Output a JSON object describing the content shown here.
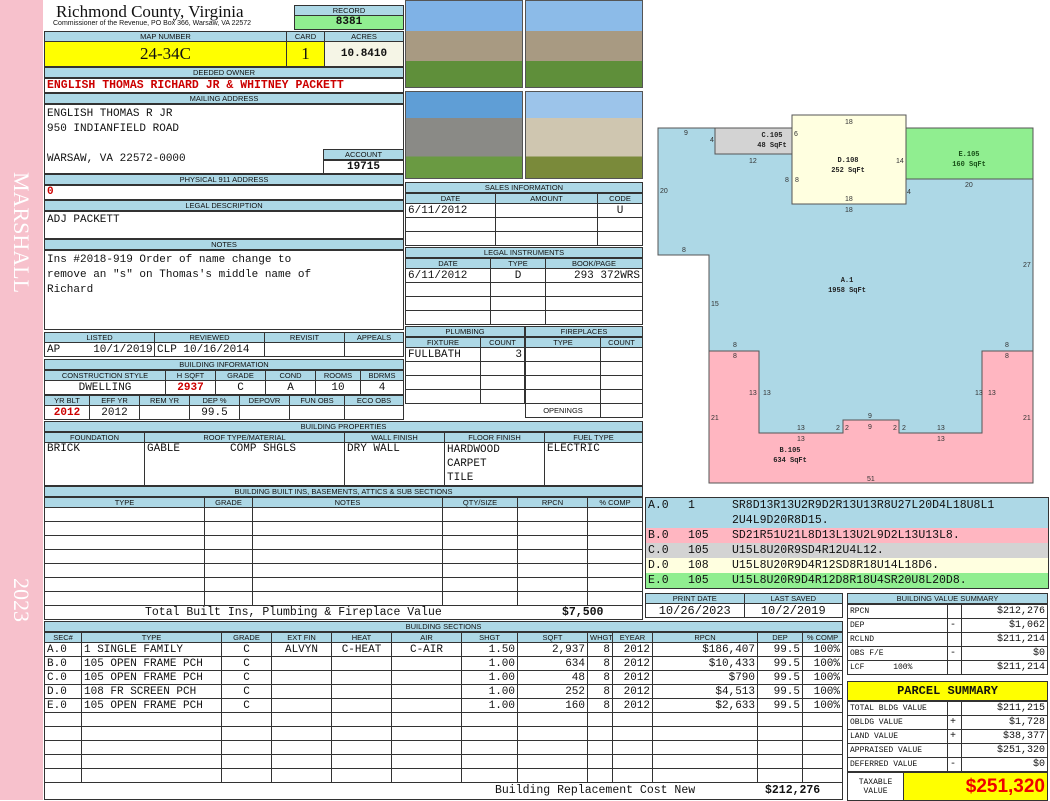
{
  "side": {
    "district": "MARSHALL",
    "year": "2023"
  },
  "header": {
    "county": "Richmond County, Virginia",
    "subtitle": "Commissioner of the Revenue, PO Box 366, Warsaw, VA 22572",
    "record_label": "RECORD",
    "record": "8381",
    "map_label": "MAP NUMBER",
    "map": "24-34C",
    "card_label": "CARD",
    "card": "1",
    "acres_label": "ACRES",
    "acres": "10.8410"
  },
  "owner": {
    "label": "DEEDED OWNER",
    "name": "ENGLISH THOMAS RICHARD JR & WHITNEY PACKETT",
    "mail_label": "MAILING ADDRESS",
    "mail": [
      "ENGLISH THOMAS R JR",
      "950 INDIANFIELD ROAD",
      "",
      "WARSAW, VA 22572-0000"
    ],
    "account_label": "ACCOUNT",
    "account": "19715",
    "phys_label": "PHYSICAL 911 ADDRESS",
    "phys": "0"
  },
  "legal": {
    "label": "LEGAL DESCRIPTION",
    "value": "ADJ PACKETT"
  },
  "notes": {
    "label": "NOTES",
    "lines": [
      "Ins #2018-919 Order of name change to",
      "remove an \"s\" on Thomas's middle name of",
      "Richard"
    ]
  },
  "sales": {
    "label": "SALES INFORMATION",
    "headers": [
      "DATE",
      "AMOUNT",
      "CODE"
    ],
    "rows": [
      [
        "6/11/2012",
        "",
        "U"
      ],
      [
        "",
        "",
        ""
      ],
      [
        "",
        "",
        ""
      ]
    ]
  },
  "instruments": {
    "label": "LEGAL INSTRUMENTS",
    "headers": [
      "DATE",
      "TYPE",
      "BOOK/PAGE"
    ],
    "rows": [
      [
        "6/11/2012",
        "D",
        "293 372WRS"
      ],
      [
        "",
        "",
        ""
      ],
      [
        "",
        "",
        ""
      ],
      [
        "",
        "",
        ""
      ]
    ]
  },
  "listing": {
    "headers": [
      "LISTED",
      "REVIEWED",
      "REVISIT",
      "APPEALS"
    ],
    "values": [
      "AP     10/1/2019",
      "CLP 10/16/2014",
      "",
      ""
    ]
  },
  "bldg_info": {
    "label": "BUILDING INFORMATION",
    "headers1": [
      "CONSTRUCTION STYLE",
      "H SQFT",
      "GRADE",
      "COND",
      "ROOMS",
      "BDRMS"
    ],
    "values1": [
      "DWELLING",
      "2937",
      "C",
      "A",
      "10",
      "4"
    ],
    "headers2": [
      "YR BLT",
      "EFF YR",
      "REM YR",
      "DEP %",
      "DEPOVR",
      "FUN OBS",
      "ECO OBS"
    ],
    "values2": [
      "2012",
      "2012",
      "",
      "99.5",
      "",
      "",
      ""
    ]
  },
  "plumbing": {
    "label": "PLUMBING",
    "headers": [
      "FIXTURE",
      "COUNT"
    ],
    "rows": [
      [
        "FULLBATH",
        "3"
      ],
      [
        "",
        ""
      ],
      [
        "",
        ""
      ],
      [
        "",
        ""
      ]
    ]
  },
  "fireplaces": {
    "label": "FIREPLACES",
    "headers": [
      "TYPE",
      "COUNT"
    ],
    "openings_label": "OPENINGS"
  },
  "props": {
    "label": "BUILDING PROPERTIES",
    "headers": [
      "FOUNDATION",
      "ROOF TYPE/MATERIAL",
      "WALL FINISH",
      "FLOOR FINISH",
      "FUEL TYPE"
    ],
    "foundation": "BRICK",
    "roof_type": "GABLE",
    "roof_mat": "COMP SHGLS",
    "wall": "DRY WALL",
    "floor": [
      "HARDWOOD",
      "CARPET",
      "TILE"
    ],
    "fuel": "ELECTRIC"
  },
  "builtins": {
    "label": "BUILDING BUILT INS, BASEMENTS, ATTICS & SUB SECTIONS",
    "headers": [
      "TYPE",
      "GRADE",
      "NOTES",
      "QTY/SIZE",
      "RPCN",
      "% COMP"
    ],
    "total_label": "Total Built Ins, Plumbing & Fireplace Value",
    "total": "$7,500"
  },
  "sections": {
    "label": "BUILDING SECTIONS",
    "headers": [
      "SEC#",
      "TYPE",
      "GRADE",
      "EXT FIN",
      "HEAT",
      "AIR",
      "SHGT",
      "SQFT",
      "WHGT",
      "EYEAR",
      "RPCN",
      "DEP",
      "% COMP"
    ],
    "rows": [
      [
        "A.0",
        "1 SINGLE FAMILY",
        "C",
        "ALVYN",
        "C-HEAT",
        "C-AIR",
        "1.50",
        "2,937",
        "8",
        "2012",
        "$186,407",
        "99.5",
        "100%"
      ],
      [
        "B.0",
        "105 OPEN FRAME PCH",
        "C",
        "",
        "",
        "",
        "1.00",
        "634",
        "8",
        "2012",
        "$10,433",
        "99.5",
        "100%"
      ],
      [
        "C.0",
        "105 OPEN FRAME PCH",
        "C",
        "",
        "",
        "",
        "1.00",
        "48",
        "8",
        "2012",
        "$790",
        "99.5",
        "100%"
      ],
      [
        "D.0",
        "108 FR SCREEN PCH",
        "C",
        "",
        "",
        "",
        "1.00",
        "252",
        "8",
        "2012",
        "$4,513",
        "99.5",
        "100%"
      ],
      [
        "E.0",
        "105 OPEN FRAME PCH",
        "C",
        "",
        "",
        "",
        "1.00",
        "160",
        "8",
        "2012",
        "$2,633",
        "99.5",
        "100%"
      ]
    ],
    "total_label": "Building Replacement Cost New",
    "total": "$212,276"
  },
  "sketch": {
    "areas": [
      {
        "id": "A.1",
        "sqft": "1958 SqFt"
      },
      {
        "id": "B.105",
        "sqft": "634 SqFt"
      },
      {
        "id": "C.105",
        "sqft": "48 SqFt"
      },
      {
        "id": "D.108",
        "sqft": "252 SqFt"
      },
      {
        "id": "E.105",
        "sqft": "160 SqFt"
      }
    ],
    "colors": {
      "A": "#add8e6",
      "B": "#ffb6c1",
      "C": "#d3d3d3",
      "D": "#ffffe0",
      "E": "#90ee90"
    },
    "codes": [
      {
        "sec": "A.0",
        "code": "1",
        "path": "SR8D13R13U2R9D2R13U13R8U27L20D4L18U8L1",
        "path2": "2U4L9D20R8D15."
      },
      {
        "sec": "B.0",
        "code": "105",
        "path": "SD21R51U21L8D13L13U2L9D2L13U13L8."
      },
      {
        "sec": "C.0",
        "code": "105",
        "path": "U15L8U20R9SD4R12U4L12."
      },
      {
        "sec": "D.0",
        "code": "108",
        "path": "U15L8U20R9D4R12SD8R18U14L18D6."
      },
      {
        "sec": "E.0",
        "code": "105",
        "path": "U15L8U20R9D4R12D8R18U4SR20U8L20D8."
      }
    ]
  },
  "dates": {
    "print_label": "PRINT DATE",
    "print": "10/26/2023",
    "saved_label": "LAST SAVED",
    "saved": "10/2/2019"
  },
  "value_summary": {
    "label": "BUILDING VALUE SUMMARY",
    "rows": [
      [
        "RPCN",
        "",
        "$212,276"
      ],
      [
        "DEP",
        "-",
        "$1,062"
      ],
      [
        "RCLND",
        "",
        "$211,214"
      ],
      [
        "OBS F/E",
        "-",
        "$0"
      ],
      [
        "LCF      100%",
        "",
        "$211,214"
      ]
    ]
  },
  "parcel": {
    "label": "PARCEL SUMMARY",
    "rows": [
      [
        "TOTAL BLDG VALUE",
        "",
        "$211,215"
      ],
      [
        "OBLDG VALUE",
        "+",
        "$1,728"
      ],
      [
        "LAND VALUE",
        "+",
        "$38,377"
      ],
      [
        "APPRAISED VALUE",
        "",
        "$251,320"
      ],
      [
        "DEFERRED VALUE",
        "-",
        "$0"
      ]
    ],
    "taxable_label": "TAXABLE VALUE",
    "taxable": "$251,320"
  }
}
